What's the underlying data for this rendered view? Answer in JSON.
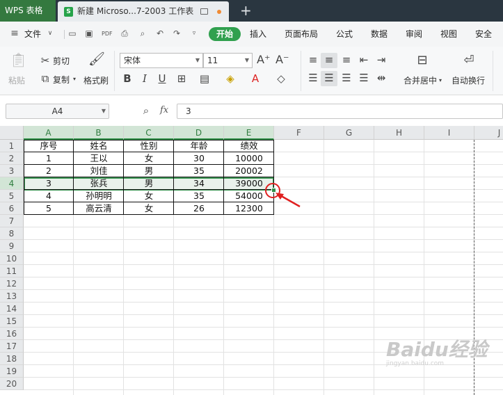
{
  "titlebar": {
    "app_name": "WPS 表格",
    "doc_icon": "S",
    "doc_title": "新建 Microso...7-2003 工作表",
    "new_tab": "+"
  },
  "menu": {
    "file": "文件",
    "tabs": [
      "开始",
      "插入",
      "页面布局",
      "公式",
      "数据",
      "审阅",
      "视图",
      "安全"
    ],
    "active_tab": "开始"
  },
  "ribbon": {
    "paste": "粘贴",
    "cut": "剪切",
    "copy": "复制",
    "format_painter": "格式刷",
    "font_name": "宋体",
    "font_size": "11",
    "merge_center": "合并居中",
    "wrap_text": "自动换行"
  },
  "formula_bar": {
    "name_box": "A4",
    "fx_label": "fx",
    "value": "3"
  },
  "sheet": {
    "columns": [
      "A",
      "B",
      "C",
      "D",
      "E",
      "F",
      "G",
      "H",
      "I",
      "J"
    ],
    "rows": [
      "1",
      "2",
      "3",
      "4",
      "5",
      "6",
      "7",
      "8",
      "9",
      "10",
      "11",
      "12",
      "13",
      "14",
      "15",
      "16",
      "17",
      "18",
      "19",
      "20"
    ],
    "selected_row": "4",
    "data": [
      [
        "序号",
        "姓名",
        "性别",
        "年龄",
        "绩效"
      ],
      [
        "1",
        "王以",
        "女",
        "30",
        "10000"
      ],
      [
        "2",
        "刘佳",
        "男",
        "35",
        "20002"
      ],
      [
        "3",
        "张兵",
        "男",
        "34",
        "39000"
      ],
      [
        "4",
        "孙明明",
        "女",
        "35",
        "54000"
      ],
      [
        "5",
        "高云清",
        "女",
        "26",
        "12300"
      ]
    ]
  },
  "watermark": {
    "text": "Baidu经验",
    "url": "jingyan.baidu.com"
  },
  "colors": {
    "accent": "#30a04e",
    "title_bg": "#2a3640",
    "annotation": "#e02020"
  }
}
